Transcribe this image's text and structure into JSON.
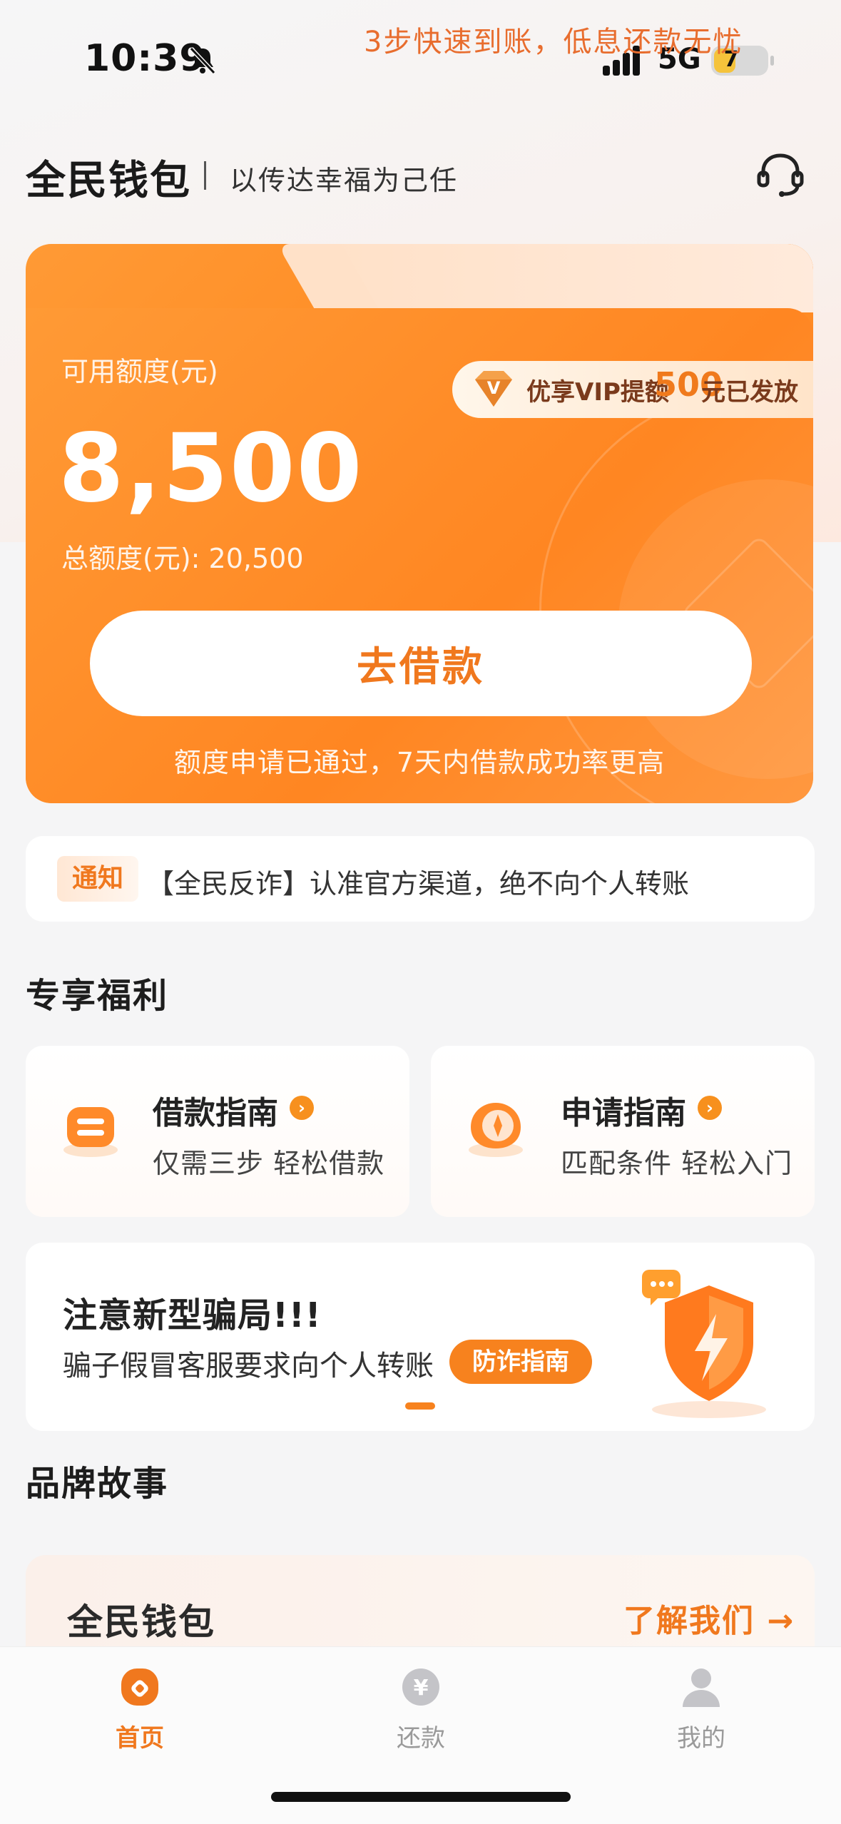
{
  "status_bar": {
    "time": "10:39",
    "network": "5G",
    "battery": "7"
  },
  "header": {
    "app_title": "全民钱包",
    "slogan": "以传达幸福为己任"
  },
  "credit_card": {
    "tab_text": "3步快速到账，低息还款无忧",
    "available_label": "可用额度(元)",
    "available_amount": "8,500",
    "total_label": "总额度(元): 20,500",
    "vip_text_prefix": "优享VIP提额",
    "vip_amount": "500",
    "vip_text_suffix": "元已发放",
    "borrow_button": "去借款",
    "note": "额度申请已通过，7天内借款成功率更高"
  },
  "notice": {
    "tag": "通知",
    "text": "【全民反诈】认准官方渠道，绝不向个人转账"
  },
  "benefits": {
    "title": "专享福利",
    "cards": [
      {
        "title": "借款指南",
        "subtitle": "仅需三步 轻松借款",
        "arrow": "›"
      },
      {
        "title": "申请指南",
        "subtitle": "匹配条件 轻松入门",
        "arrow": "›"
      }
    ]
  },
  "fraud_banner": {
    "title": "注意新型骗局!!!",
    "text": "骗子假冒客服要求向个人转账",
    "button": "防诈指南"
  },
  "brand_story": {
    "title": "品牌故事",
    "card_title": "全民钱包",
    "link": "了解我们 →"
  },
  "tabbar": [
    {
      "label": "首页",
      "icon": "home-icon",
      "active": true
    },
    {
      "label": "还款",
      "icon": "yuan-icon",
      "active": false
    },
    {
      "label": "我的",
      "icon": "person-icon",
      "active": false
    }
  ],
  "colors": {
    "accent": "#f0781e",
    "card_orange": "#ff8a22"
  }
}
